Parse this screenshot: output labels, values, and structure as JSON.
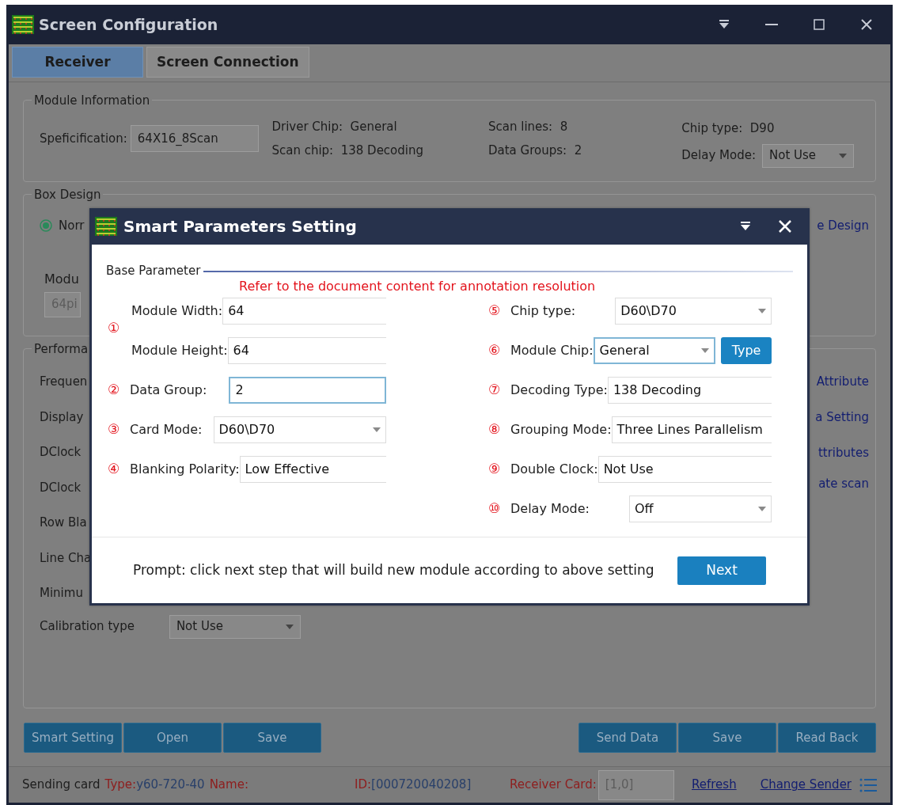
{
  "window": {
    "title": "Screen Configuration"
  },
  "tabs": [
    {
      "label": "Receiver",
      "selected": true
    },
    {
      "label": "Screen Connection",
      "selected": false
    }
  ],
  "module_information": {
    "legend": "Module Information",
    "specification": {
      "label": "Speficification:",
      "value": "64X16_8Scan"
    },
    "columns": [
      [
        "Driver Chip:  General",
        "Scan chip:  138 Decoding"
      ],
      [
        "Scan lines:  8",
        "Data Groups:  2"
      ],
      [
        "Chip type:  D90"
      ]
    ],
    "delay_mode": {
      "label": "Delay Mode:",
      "value": "Not Use"
    }
  },
  "box_design": {
    "legend": "Box Design",
    "radio": {
      "label": "Norr",
      "selected": true
    },
    "link": "e Design",
    "field_label": "Modu",
    "field_value": "64pi"
  },
  "performance": {
    "legend": "Performa",
    "labels": [
      "Frequen",
      "Display",
      "DClock",
      "DClock",
      "Row Bla",
      "Line Cha",
      "Minimu"
    ],
    "calibration": {
      "label": "Calibration type",
      "value": "Not Use"
    },
    "links": [
      "Attribute",
      "a Setting",
      "ttributes",
      "ate scan"
    ]
  },
  "buttons_left": [
    "Smart Setting",
    "Open",
    "Save"
  ],
  "buttons_right": [
    "Send Data",
    "Save",
    "Read Back"
  ],
  "status_bar": {
    "groups": [
      [
        {
          "text": "Sending card",
          "kind": "label"
        },
        {
          "text": "Type:",
          "kind": "key"
        },
        {
          "text": "y60-720-40",
          "kind": "value"
        },
        {
          "text": "Name:",
          "kind": "key"
        }
      ],
      [
        {
          "text": "ID:",
          "kind": "key"
        },
        {
          "text": "[000720040208]",
          "kind": "value"
        }
      ],
      [
        {
          "text": "Receiver Card:",
          "kind": "key"
        },
        {
          "text": "[1,0]",
          "kind": "field"
        }
      ]
    ],
    "links": [
      "Refresh",
      "Change Sender"
    ]
  },
  "dialog": {
    "title": "Smart Parameters Setting",
    "legend": "Base Parameter",
    "note": "Refer to the document content for annotation resolution",
    "left": [
      {
        "marker": "①",
        "fields": [
          {
            "label": "Module Width:",
            "value": "64",
            "kind": "text",
            "focused": false
          },
          {
            "label": "Module Height:",
            "value": "64",
            "kind": "text",
            "focused": false
          }
        ]
      },
      {
        "marker": "②",
        "fields": [
          {
            "label": "Data Group:",
            "value": "2",
            "kind": "text",
            "focused": true
          }
        ]
      },
      {
        "marker": "③",
        "fields": [
          {
            "label": "Card Mode:",
            "value": "D60\\D70",
            "kind": "select",
            "focused": false
          }
        ]
      },
      {
        "marker": "④",
        "fields": [
          {
            "label": "Blanking Polarity:",
            "value": "Low Effective",
            "kind": "text",
            "focused": false
          }
        ]
      }
    ],
    "right": [
      {
        "marker": "⑤",
        "fields": [
          {
            "label": "Chip type:",
            "value": "D60\\D70",
            "kind": "select",
            "focused": false
          }
        ]
      },
      {
        "marker": "⑥",
        "fields": [
          {
            "label": "Module Chip:",
            "value": "General",
            "kind": "select",
            "focused": true,
            "button": "Type"
          }
        ]
      },
      {
        "marker": "⑦",
        "fields": [
          {
            "label": "Decoding Type:",
            "value": "138 Decoding",
            "kind": "text",
            "focused": false
          }
        ]
      },
      {
        "marker": "⑧",
        "fields": [
          {
            "label": "Grouping Mode:",
            "value": "Three Lines Parallelism",
            "kind": "text",
            "focused": false
          }
        ]
      },
      {
        "marker": "⑨",
        "fields": [
          {
            "label": "Double Clock:",
            "value": "Not Use",
            "kind": "text",
            "focused": false
          }
        ]
      },
      {
        "marker": "⑩",
        "fields": [
          {
            "label": "Delay Mode:",
            "value": "Off",
            "kind": "select",
            "focused": false
          }
        ]
      }
    ],
    "prompt": "Prompt: click next step that will build new module according to above setting",
    "next_button": "Next"
  }
}
